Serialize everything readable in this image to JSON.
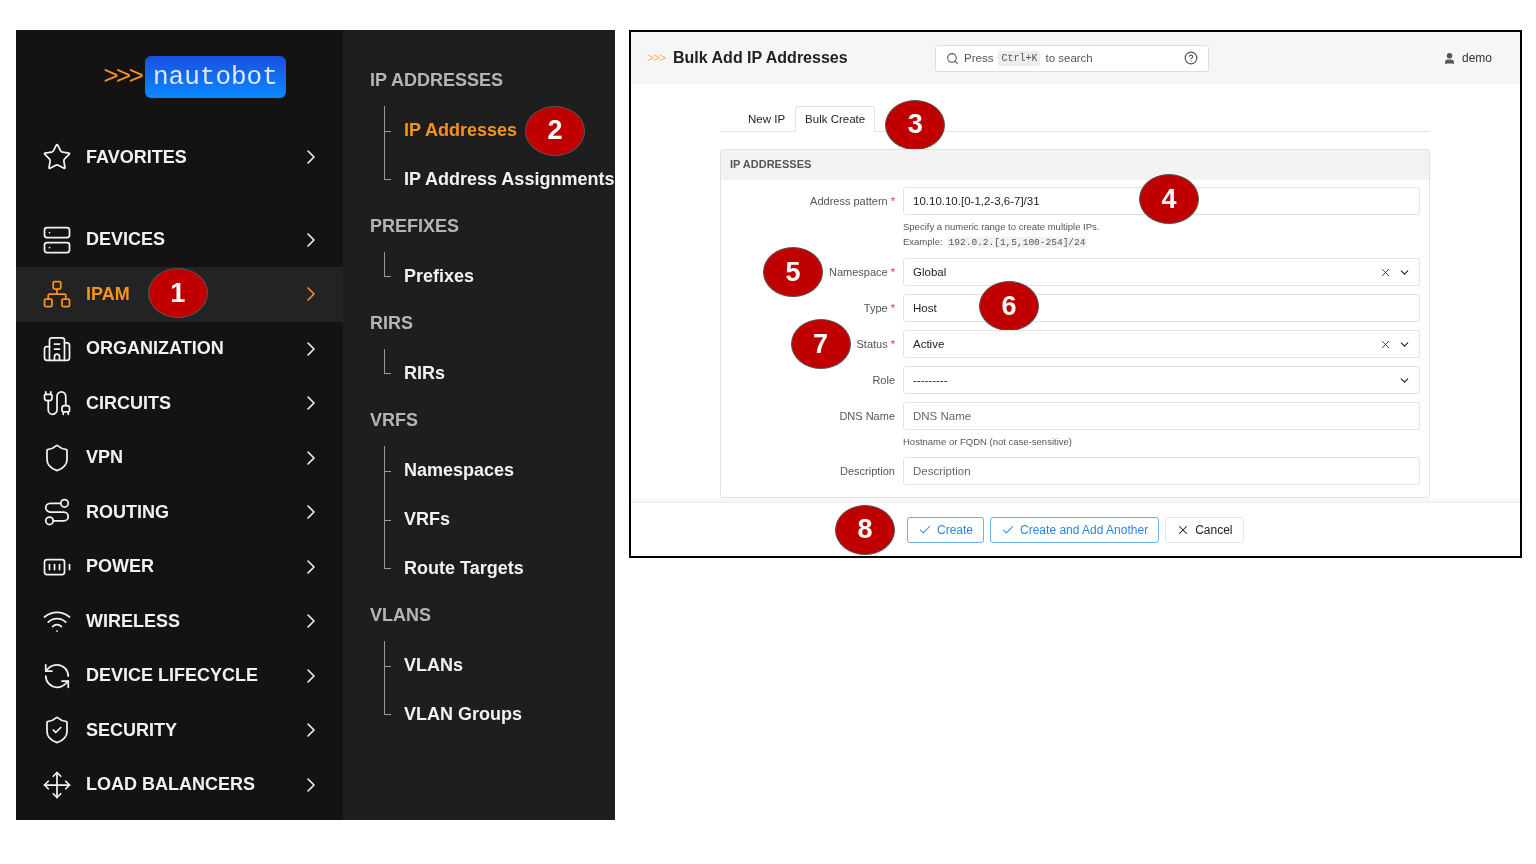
{
  "sidebar": {
    "logo": {
      "chevrons": ">>>",
      "name": "nautobot"
    },
    "items": [
      {
        "label": "FAVORITES",
        "selected": false
      },
      {
        "label": "DEVICES",
        "selected": false
      },
      {
        "label": "IPAM",
        "selected": true,
        "callout": "1"
      },
      {
        "label": "ORGANIZATION",
        "selected": false
      },
      {
        "label": "CIRCUITS",
        "selected": false
      },
      {
        "label": "VPN",
        "selected": false
      },
      {
        "label": "ROUTING",
        "selected": false
      },
      {
        "label": "POWER",
        "selected": false
      },
      {
        "label": "WIRELESS",
        "selected": false
      },
      {
        "label": "DEVICE LIFECYCLE",
        "selected": false
      },
      {
        "label": "SECURITY",
        "selected": false
      },
      {
        "label": "LOAD BALANCERS",
        "selected": false
      }
    ]
  },
  "submenu": {
    "sections": [
      {
        "heading": "IP ADDRESSES",
        "items": [
          {
            "label": "IP Addresses",
            "selected": true,
            "callout": "2"
          },
          {
            "label": "IP Address Assignments",
            "selected": false
          }
        ]
      },
      {
        "heading": "PREFIXES",
        "items": [
          {
            "label": "Prefixes",
            "selected": false
          }
        ]
      },
      {
        "heading": "RIRS",
        "items": [
          {
            "label": "RIRs",
            "selected": false
          }
        ]
      },
      {
        "heading": "VRFS",
        "items": [
          {
            "label": "Namespaces",
            "selected": false
          },
          {
            "label": "VRFs",
            "selected": false
          },
          {
            "label": "Route Targets",
            "selected": false
          }
        ]
      },
      {
        "heading": "VLANS",
        "items": [
          {
            "label": "VLANs",
            "selected": false
          },
          {
            "label": "VLAN Groups",
            "selected": false
          }
        ]
      }
    ]
  },
  "page": {
    "chevrons": ">>>",
    "title": "Bulk Add IP Addresses",
    "search": {
      "before": "Press",
      "key": "Ctrl+K",
      "after": "to search"
    },
    "user": "demo",
    "tabs": [
      {
        "label": "New IP",
        "selected": false
      },
      {
        "label": "Bulk Create",
        "selected": true,
        "callout": "3"
      }
    ],
    "card_title": "IP ADDRESSES",
    "fields": [
      {
        "label": "Address pattern",
        "required_mark": "*",
        "kind": "text",
        "value": "10.10.10.[0-1,2-3,6-7]/31",
        "help": "Specify a numeric range to create multiple IPs.",
        "example_label": "Example:",
        "example_code": "192.0.2.[1,5,100-254]/24",
        "input_callout": "4"
      },
      {
        "label": "Namespace",
        "required_mark": "*",
        "kind": "select",
        "value": "Global",
        "clearable": true,
        "label_callout": "5"
      },
      {
        "label": "Type",
        "required_mark": "*",
        "kind": "text",
        "value": "Host",
        "input_callout": "6"
      },
      {
        "label": "Status",
        "required_mark": "*",
        "kind": "select",
        "value": "Active",
        "clearable": true,
        "label_callout": "7"
      },
      {
        "label": "Role",
        "kind": "select",
        "value": "---------",
        "clearable": false
      },
      {
        "label": "DNS Name",
        "kind": "text",
        "placeholder": "DNS Name",
        "help": "Hostname or FQDN (not case-sensitive)"
      },
      {
        "label": "Description",
        "kind": "text",
        "placeholder": "Description"
      }
    ],
    "actions_callout": "8",
    "buttons": [
      {
        "label": "Create",
        "kind": "primary"
      },
      {
        "label": "Create and Add Another",
        "kind": "primary"
      },
      {
        "label": "Cancel",
        "kind": "cancel"
      }
    ]
  }
}
